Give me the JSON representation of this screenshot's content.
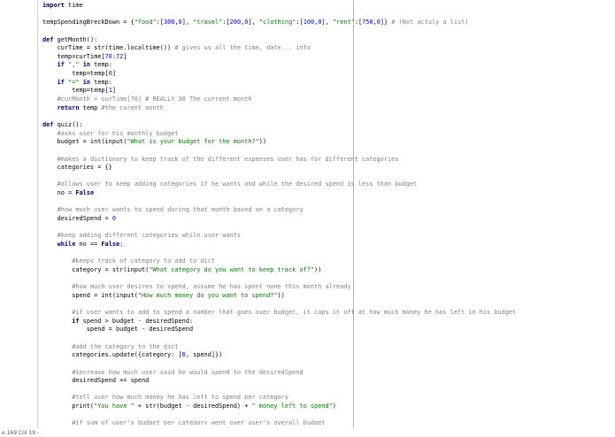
{
  "editor": {
    "lines": [
      [
        {
          "t": "import",
          "c": "kw"
        },
        {
          "t": " time"
        }
      ],
      [],
      [
        {
          "t": "tempSpendingBreckDown = {"
        },
        {
          "t": "\"food\"",
          "c": "str"
        },
        {
          "t": ":["
        },
        {
          "t": "300",
          "c": "num"
        },
        {
          "t": ","
        },
        {
          "t": "0",
          "c": "num"
        },
        {
          "t": "], "
        },
        {
          "t": "\"travel\"",
          "c": "str"
        },
        {
          "t": ":["
        },
        {
          "t": "200",
          "c": "num"
        },
        {
          "t": ","
        },
        {
          "t": "0",
          "c": "num"
        },
        {
          "t": "], "
        },
        {
          "t": "\"clothing\"",
          "c": "str"
        },
        {
          "t": ":["
        },
        {
          "t": "100",
          "c": "num"
        },
        {
          "t": ","
        },
        {
          "t": "0",
          "c": "num"
        },
        {
          "t": "], "
        },
        {
          "t": "\"rent\"",
          "c": "str"
        },
        {
          "t": ":["
        },
        {
          "t": "750",
          "c": "num"
        },
        {
          "t": ","
        },
        {
          "t": "0",
          "c": "num"
        },
        {
          "t": "]} "
        },
        {
          "t": "# (Not actuly a list)",
          "c": "com"
        }
      ],
      [],
      [
        {
          "t": "def",
          "c": "kw"
        },
        {
          "t": " getMonth():"
        }
      ],
      [
        {
          "t": "    curTime = str(time.localtime()) "
        },
        {
          "t": "# gives us all the time, date... info",
          "c": "com"
        }
      ],
      [
        {
          "t": "    temp=curTime["
        },
        {
          "t": "70",
          "c": "num"
        },
        {
          "t": ":"
        },
        {
          "t": "72",
          "c": "num"
        },
        {
          "t": "]"
        }
      ],
      [
        {
          "t": "    "
        },
        {
          "t": "if",
          "c": "kw"
        },
        {
          "t": " "
        },
        {
          "t": "\",\"",
          "c": "str"
        },
        {
          "t": " "
        },
        {
          "t": "in",
          "c": "kw"
        },
        {
          "t": " temp:"
        }
      ],
      [
        {
          "t": "        temp=temp["
        },
        {
          "t": "0",
          "c": "num"
        },
        {
          "t": "]"
        }
      ],
      [
        {
          "t": "    "
        },
        {
          "t": "if",
          "c": "kw"
        },
        {
          "t": " "
        },
        {
          "t": "\"=\"",
          "c": "str"
        },
        {
          "t": " "
        },
        {
          "t": "in",
          "c": "kw"
        },
        {
          "t": " temp:"
        }
      ],
      [
        {
          "t": "        temp=temp["
        },
        {
          "t": "1",
          "c": "num"
        },
        {
          "t": "]"
        }
      ],
      [
        {
          "t": "    "
        },
        {
          "t": "#curMonth = curTime[70] # REALLY 38 The current month",
          "c": "com"
        }
      ],
      [
        {
          "t": "    "
        },
        {
          "t": "return",
          "c": "kw"
        },
        {
          "t": " temp "
        },
        {
          "t": "#the curent month",
          "c": "com"
        }
      ],
      [],
      [
        {
          "t": "def",
          "c": "kw"
        },
        {
          "t": " quiz():"
        }
      ],
      [
        {
          "t": "    "
        },
        {
          "t": "#asks user for his monthly budget",
          "c": "com"
        }
      ],
      [
        {
          "t": "    budget = int(input("
        },
        {
          "t": "\"What is your budget for the month?\"",
          "c": "str"
        },
        {
          "t": "))"
        }
      ],
      [],
      [
        {
          "t": "    "
        },
        {
          "t": "#makes a dictionary to keep track of the different expenses user has for different categories",
          "c": "com"
        }
      ],
      [
        {
          "t": "    categories = {}"
        }
      ],
      [],
      [
        {
          "t": "    "
        },
        {
          "t": "#allows user to keep adding categories if he wants and while the desired spend is less than budget",
          "c": "com"
        }
      ],
      [
        {
          "t": "    no = "
        },
        {
          "t": "False",
          "c": "kw"
        }
      ],
      [],
      [
        {
          "t": "    "
        },
        {
          "t": "#how much user wants to spend during that month based on a category",
          "c": "com"
        }
      ],
      [
        {
          "t": "    desiredSpend = "
        },
        {
          "t": "0",
          "c": "num"
        }
      ],
      [],
      [
        {
          "t": "    "
        },
        {
          "t": "#keep adding different categories while user wants",
          "c": "com"
        }
      ],
      [
        {
          "t": "    "
        },
        {
          "t": "while",
          "c": "kw"
        },
        {
          "t": " no == "
        },
        {
          "t": "False",
          "c": "kw"
        },
        {
          "t": ":"
        }
      ],
      [],
      [
        {
          "t": "        "
        },
        {
          "t": "#keeps track of category to add to dict",
          "c": "com"
        }
      ],
      [
        {
          "t": "        category = str(input("
        },
        {
          "t": "\"What category do you want to keep track of?\"",
          "c": "str"
        },
        {
          "t": "))"
        }
      ],
      [],
      [
        {
          "t": "        "
        },
        {
          "t": "#how much user desires to spend, assume he has spent none this month already",
          "c": "com"
        }
      ],
      [
        {
          "t": "        spend = int(input("
        },
        {
          "t": "\"How much money do you want to spend?\"",
          "c": "str"
        },
        {
          "t": "))"
        }
      ],
      [],
      [
        {
          "t": "        "
        },
        {
          "t": "#if user wants to add to spend a number that goes over budget, it caps it off at how much money he has left in his budget",
          "c": "com"
        }
      ],
      [
        {
          "t": "        "
        },
        {
          "t": "if",
          "c": "kw"
        },
        {
          "t": " spend > budget - desiredSpend:"
        }
      ],
      [
        {
          "t": "            spend = budget - desiredSpend"
        }
      ],
      [],
      [
        {
          "t": "        "
        },
        {
          "t": "#add the category to the dict",
          "c": "com"
        }
      ],
      [
        {
          "t": "        categories.update({category: ["
        },
        {
          "t": "0",
          "c": "num"
        },
        {
          "t": ", spend]})"
        }
      ],
      [],
      [
        {
          "t": "        "
        },
        {
          "t": "#increase how much user said he would spend to the desiredSpend",
          "c": "com"
        }
      ],
      [
        {
          "t": "        desiredSpend += spend"
        }
      ],
      [],
      [
        {
          "t": "        "
        },
        {
          "t": "#tell user how much money he has left to spend per category",
          "c": "com"
        }
      ],
      [
        {
          "t": "        print("
        },
        {
          "t": "\"You have \"",
          "c": "str"
        },
        {
          "t": " + str(budget - desiredSpend) + "
        },
        {
          "t": "\" money left to spend\"",
          "c": "str"
        },
        {
          "t": ")"
        }
      ],
      [],
      [
        {
          "t": "        "
        },
        {
          "t": "#if sum of user's budget per category went over user's overall budget",
          "c": "com"
        }
      ]
    ]
  },
  "status_bar": {
    "position": "e 169 Col 19 -"
  }
}
